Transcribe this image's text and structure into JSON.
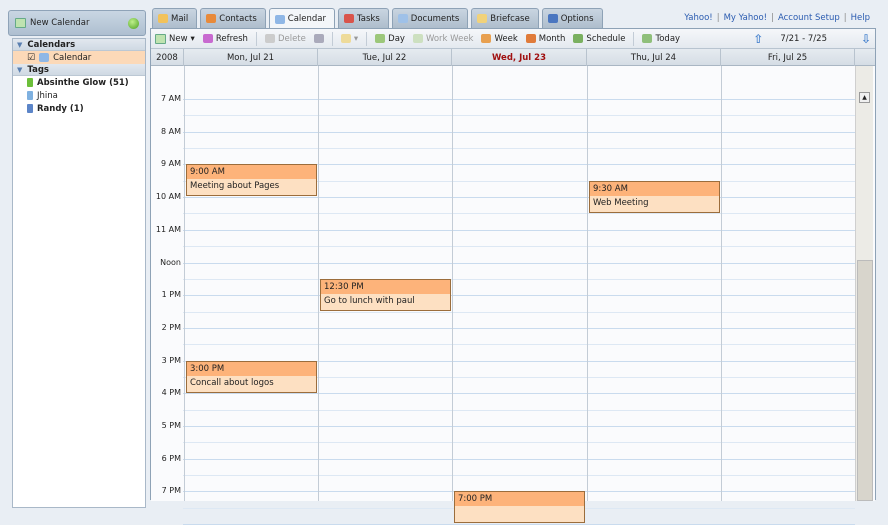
{
  "sidebar": {
    "new_calendar": "New Calendar",
    "calendars_header": "Calendars",
    "calendar_item": "Calendar",
    "tags_header": "Tags",
    "tags": [
      {
        "label": "Absinthe Glow (51)",
        "color": "#6cbf3a",
        "bold": true
      },
      {
        "label": "Jhina",
        "color": "#7fb1e0",
        "bold": false
      },
      {
        "label": "Randy (1)",
        "color": "#5c85c8",
        "bold": true
      }
    ]
  },
  "tabs": [
    {
      "label": "Mail",
      "color": "#f2c25a"
    },
    {
      "label": "Contacts",
      "color": "#e88a3a"
    },
    {
      "label": "Calendar",
      "color": "#8fb7e6"
    },
    {
      "label": "Tasks",
      "color": "#d9544b"
    },
    {
      "label": "Documents",
      "color": "#9fc1e8"
    },
    {
      "label": "Briefcase",
      "color": "#f1d27a"
    },
    {
      "label": "Options",
      "color": "#4a76c0"
    }
  ],
  "links": [
    "Yahoo!",
    "My Yahoo!",
    "Account Setup",
    "Help"
  ],
  "toolbar": {
    "new": "New",
    "refresh": "Refresh",
    "delete": "Delete",
    "day": "Day",
    "work_week": "Work Week",
    "week": "Week",
    "month": "Month",
    "schedule": "Schedule",
    "today": "Today",
    "range": "7/21 - 7/25"
  },
  "header": {
    "year": "2008",
    "days": [
      "Mon, Jul 21",
      "Tue, Jul 22",
      "Wed, Jul 23",
      "Thu, Jul 24",
      "Fri, Jul 25"
    ],
    "today_color": "#a01010"
  },
  "hours": [
    "7 AM",
    "8 AM",
    "9 AM",
    "10 AM",
    "11 AM",
    "Noon",
    "1 PM",
    "2 PM",
    "3 PM",
    "4 PM",
    "5 PM",
    "6 PM",
    "7 PM"
  ],
  "events": [
    {
      "day": 0,
      "start": 9,
      "time": "9:00 AM",
      "title": "Meeting about Pages"
    },
    {
      "day": 1,
      "start": 12.5,
      "time": "12:30 PM",
      "title": "Go to lunch with paul"
    },
    {
      "day": 3,
      "start": 9.5,
      "time": "9:30 AM",
      "title": "Web Meeting"
    },
    {
      "day": 0,
      "start": 15,
      "time": "3:00 PM",
      "title": "Concall about logos"
    },
    {
      "day": 2,
      "start": 19,
      "time": "7:00 PM",
      "title": ""
    }
  ]
}
